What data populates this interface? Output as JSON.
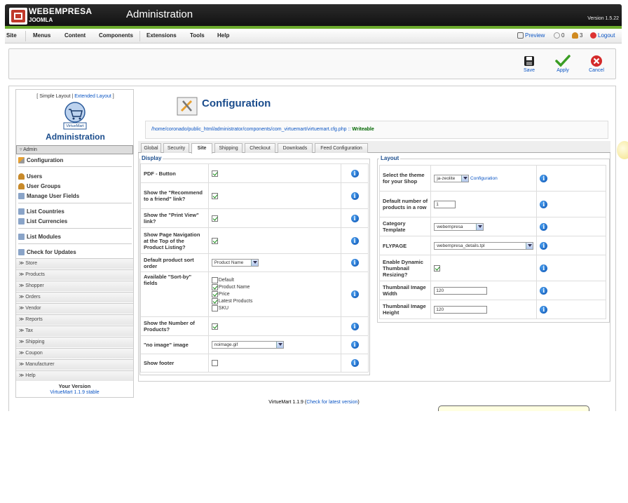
{
  "header": {
    "brand": "WEBEMPRESA",
    "brand_sub": "JOOMLA",
    "title": "Administration",
    "version": "Version 1.5.22"
  },
  "menubar": {
    "items": [
      "Site",
      "Menus",
      "Content",
      "Components",
      "Extensions",
      "Tools",
      "Help"
    ],
    "preview": "Preview",
    "messages": "0",
    "users_online": "3",
    "logout": "Logout"
  },
  "toolbar": {
    "save": "Save",
    "apply": "Apply",
    "cancel": "Cancel"
  },
  "sidebar": {
    "simple_layout": "Simple Layout",
    "extended_layout": "Extended Layout",
    "logo_text": "VirtueMart",
    "title": "Administration",
    "section": "Admin",
    "links": [
      "Configuration",
      "Users",
      "User Groups",
      "Manage User Fields",
      "List Countries",
      "List Currencies",
      "List Modules",
      "Check for Updates"
    ],
    "categories": [
      "Store",
      "Products",
      "Shopper",
      "Orders",
      "Vendor",
      "Reports",
      "Tax",
      "Shipping",
      "Coupon",
      "Manufacturer",
      "Help"
    ],
    "version_label": "Your Version",
    "version_value": "VirtueMart 1.1.9 stable"
  },
  "config": {
    "title": "Configuration",
    "path": "/home/coronado/public_html/administrator/components/com_virtuemart/virtuemart.cfg.php :: ",
    "path_status": "Writeable"
  },
  "tabs": [
    "Global",
    "Security",
    "Site",
    "Shipping",
    "Checkout",
    "Downloads",
    "Feed Configuration"
  ],
  "active_tab": "Site",
  "display": {
    "legend": "Display",
    "pdf_button": "PDF - Button",
    "recommend": "Show the \"Recommend to a friend\" link?",
    "print_view": "Show the \"Print View\" link?",
    "page_nav": "Show Page Navigation at the Top of the Product Listing?",
    "default_sort": "Default product sort order",
    "default_sort_value": "Product Name",
    "sort_by": "Available \"Sort-by\" fields",
    "sort_options": [
      "Default",
      "Product Name",
      "Price",
      "Latest Products",
      "SKU"
    ],
    "sort_checked": [
      false,
      true,
      true,
      true,
      false
    ],
    "num_products": "Show the Number of Products?",
    "no_image": "\"no image\" image",
    "no_image_value": "noimage.gif",
    "show_footer": "Show footer",
    "pdf_checked": true,
    "recommend_checked": true,
    "print_checked": true,
    "page_nav_checked": true,
    "num_products_checked": true,
    "footer_checked": false
  },
  "layout": {
    "legend": "Layout",
    "theme": "Select the theme for your Shop",
    "theme_value": "ja-zeolite",
    "theme_link": "Configuration",
    "per_row": "Default number of products in a row",
    "per_row_value": "1",
    "category_template": "Category Template",
    "category_template_value": "webempresa",
    "flypage": "FLYPAGE",
    "flypage_value": "webempresa_details.tpl",
    "dynamic_thumb": "Enable Dynamic Thumbnail Resizing?",
    "dynamic_thumb_checked": true,
    "thumb_width": "Thumbnail Image Width",
    "thumb_width_value": "120",
    "thumb_height": "Thumbnail Image Height",
    "thumb_height_value": "120"
  },
  "footer": {
    "version_text": "VirtueMart 1.1.9 (",
    "check_link": "Check for latest version",
    "version_end": ")"
  },
  "colors": {
    "accent_green": "#6cab2d",
    "link_blue": "#0b55c4",
    "title_blue": "#1a4c8c"
  }
}
